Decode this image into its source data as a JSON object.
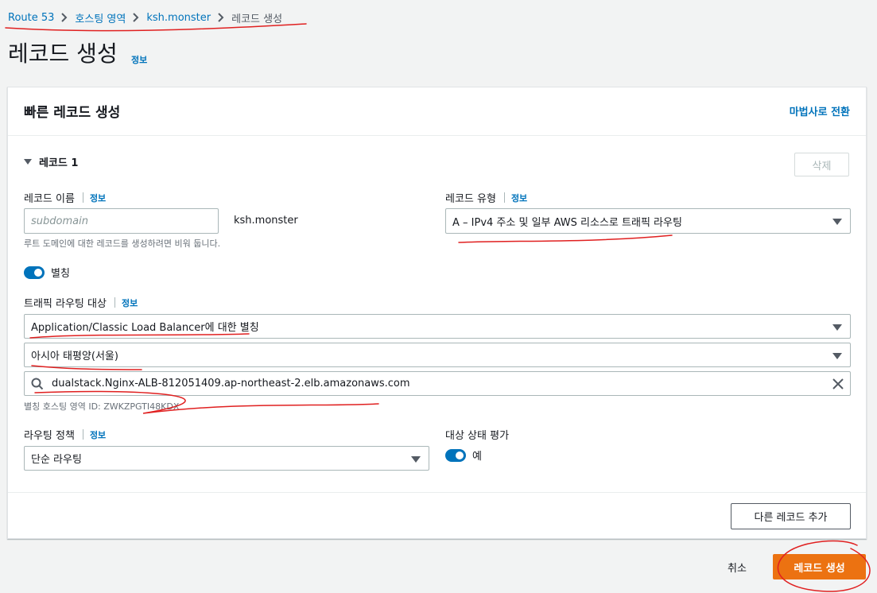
{
  "breadcrumb": {
    "items": [
      "Route 53",
      "호스팅 영역",
      "ksh.monster"
    ],
    "current": "레코드 생성"
  },
  "page": {
    "title": "레코드 생성",
    "info": "정보"
  },
  "panel": {
    "title": "빠른 레코드 생성",
    "wizard_link": "마법사로 전환",
    "record_header": "레코드 1",
    "delete_button": "삭제",
    "record_name": {
      "label": "레코드 이름",
      "info": "정보",
      "placeholder": "subdomain",
      "domain_suffix": "ksh.monster",
      "hint": "루트 도메인에 대한 레코드를 생성하려면 비워 둡니다."
    },
    "record_type": {
      "label": "레코드 유형",
      "info": "정보",
      "value": "A – IPv4 주소 및 일부 AWS 리소스로 트래픽 라우팅"
    },
    "alias": {
      "label": "별칭",
      "enabled": true
    },
    "traffic_target": {
      "label": "트래픽 라우팅 대상",
      "info": "정보",
      "endpoint": "Application/Classic Load Balancer에 대한 별칭",
      "region": "아시아 태평양(서울)",
      "load_balancer": "dualstack.Nginx-ALB-812051409.ap-northeast-2.elb.amazonaws.com",
      "hint": "별칭 호스팅 영역 ID: ZWKZPGTI48KDX"
    },
    "routing_policy": {
      "label": "라우팅 정책",
      "info": "정보",
      "value": "단순 라우팅"
    },
    "health": {
      "label": "대상 상태 평가",
      "toggle_label": "예",
      "enabled": true
    },
    "add_record_button": "다른 레코드 추가"
  },
  "footer": {
    "cancel": "취소",
    "create": "레코드 생성"
  },
  "colors": {
    "accent": "#0073bb",
    "primary_button": "#ec7211",
    "annotation": "#e02020"
  },
  "icons": {
    "search": "search-icon",
    "clear": "close-icon",
    "caret": "caret-down-icon",
    "chevron": "chevron-right-icon"
  }
}
